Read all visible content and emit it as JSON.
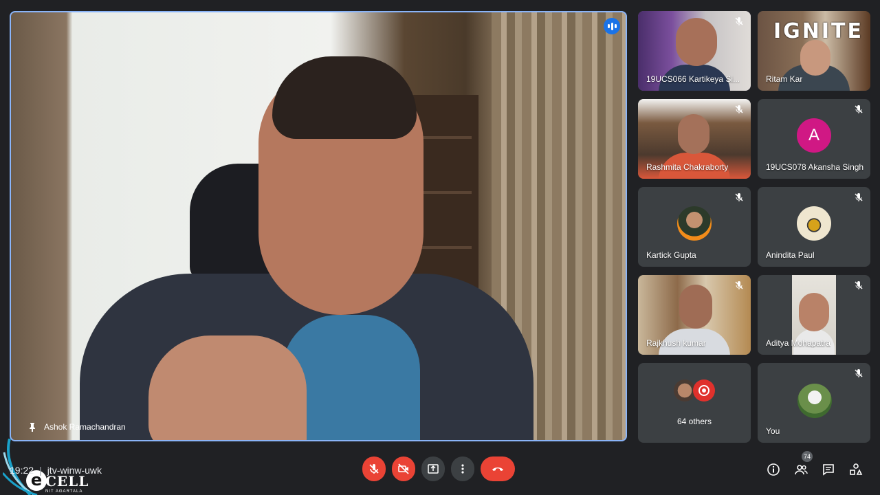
{
  "main_speaker": {
    "name": "Ashok Ramachandran"
  },
  "overlay": {
    "brand": "IGNITE"
  },
  "tiles": [
    {
      "name": "19UCS066 Kartikeya Si...",
      "type": "video"
    },
    {
      "name": "Ritam Kar",
      "type": "video"
    },
    {
      "name": "Rashmita Chakraborty",
      "type": "video"
    },
    {
      "name": "19UCS078 Akansha Singh",
      "type": "avatar",
      "initial": "A",
      "color": "#d01884"
    },
    {
      "name": "Kartick Gupta",
      "type": "photo"
    },
    {
      "name": "Anindita Paul",
      "type": "photo"
    },
    {
      "name": "Rajkhush kumar",
      "type": "video"
    },
    {
      "name": "Aditya Mohapatra",
      "type": "video"
    },
    {
      "name": "64 others",
      "type": "others"
    },
    {
      "name": "You",
      "type": "photo"
    }
  ],
  "meeting": {
    "time": "19:22",
    "separator": "|",
    "code": "jtv-winw-uwk"
  },
  "logo": {
    "letter": "e",
    "word": "CELL",
    "sub": "NIT AGARTALA"
  },
  "controls": [
    "mic-off",
    "camera-off",
    "present",
    "more",
    "end-call"
  ],
  "people_count": "74",
  "colors": {
    "accent": "#8ab4f8",
    "danger": "#ea4335",
    "tile_bg": "#3c4043",
    "bg": "#202124"
  }
}
